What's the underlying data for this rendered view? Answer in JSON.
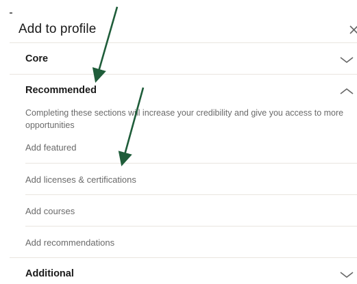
{
  "dialog": {
    "title": "Add to profile"
  },
  "sections": {
    "core": {
      "label": "Core",
      "state": "collapsed"
    },
    "recommended": {
      "label": "Recommended",
      "state": "expanded",
      "description": "Completing these sections will increase your credibility and give you access to more opportunities",
      "items": [
        {
          "label": "Add featured"
        },
        {
          "label": "Add licenses & certifications"
        },
        {
          "label": "Add courses"
        },
        {
          "label": "Add recommendations"
        }
      ]
    },
    "additional": {
      "label": "Additional",
      "state": "collapsed"
    }
  },
  "icons": {
    "close": "close-icon",
    "expand": "chevron-down-icon",
    "collapse": "chevron-up-icon"
  },
  "colors": {
    "annotation_arrow": "#1f5d3a",
    "divider": "#e9e5df",
    "chevron": "#666666"
  }
}
